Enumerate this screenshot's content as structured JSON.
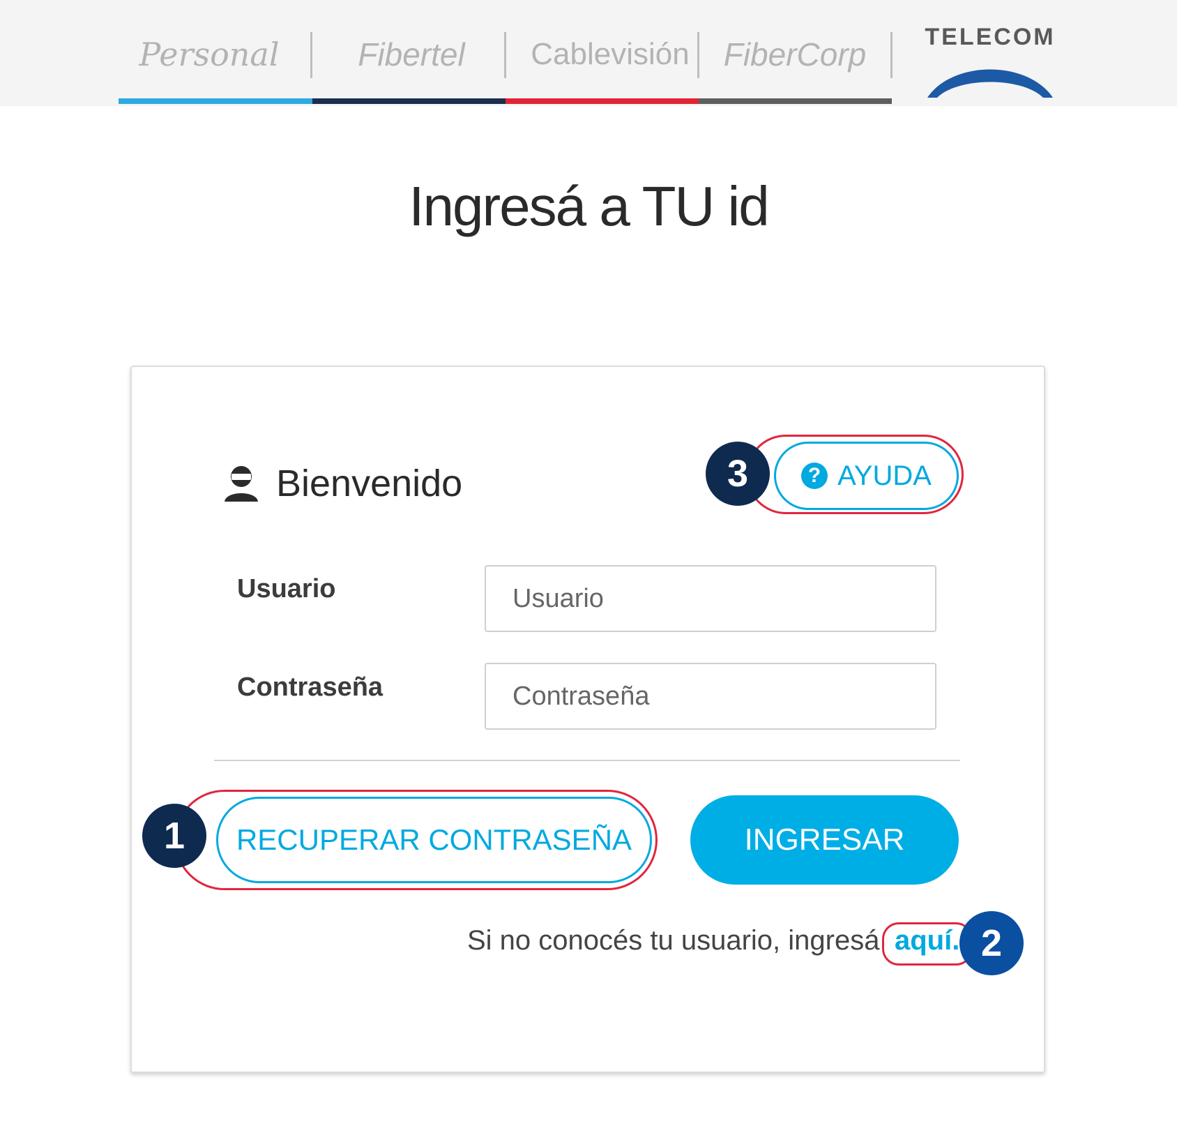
{
  "header": {
    "brands": [
      "Personal",
      "Fibertel",
      "Cablevisión",
      "FiberCorp"
    ],
    "company": "TELECOM",
    "brand_colors": [
      "#2fa9e0",
      "#1c2e4f",
      "#e12434",
      "#5e5e5e"
    ]
  },
  "page": {
    "title": "Ingresá a TU id"
  },
  "card": {
    "welcome": "Bienvenido",
    "help_label": "AYUDA",
    "help_icon": "?",
    "user_label": "Usuario",
    "user_placeholder": "Usuario",
    "password_label": "Contraseña",
    "password_placeholder": "Contraseña",
    "recover_label": "RECUPERAR CONTRASEÑA",
    "login_label": "INGRESAR",
    "hint_text": "Si no conocés tu usuario, ingresá",
    "hint_link": "aquí."
  },
  "annotations": {
    "step1": "1",
    "step2": "2",
    "step3": "3"
  },
  "colors": {
    "accent": "#00a9e0",
    "highlight": "#e0263d",
    "badge_dark": "#0e2a4f",
    "badge_blue": "#0a4fa0"
  }
}
